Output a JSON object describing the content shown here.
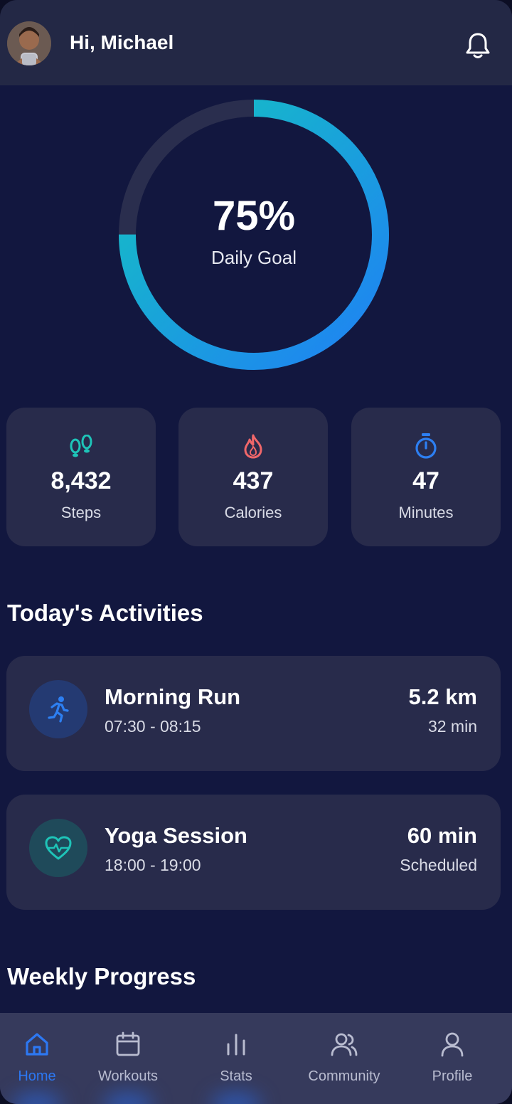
{
  "header": {
    "greeting": "Hi, Michael",
    "avatar_icon": "user-avatar-photo",
    "notification_icon": "bell-icon"
  },
  "goal": {
    "percent_text": "75%",
    "progress": 0.75,
    "label": "Daily Goal",
    "colors": {
      "track": "#2a2e4e",
      "gradient_start": "#14c4c0",
      "gradient_end": "#1f80f5"
    }
  },
  "stats": [
    {
      "value": "8,432",
      "label": "Steps",
      "icon": "footprints-icon",
      "color": "#1ec4b8"
    },
    {
      "value": "437",
      "label": "Calories",
      "icon": "flame-icon",
      "color": "#f0676a"
    },
    {
      "value": "47",
      "label": "Minutes",
      "icon": "stopwatch-icon",
      "color": "#2d7ff2"
    }
  ],
  "activities_title": "Today's Activities",
  "activities": [
    {
      "title": "Morning Run",
      "time": "07:30 - 08:15",
      "metric": "5.2 km",
      "sub": "32 min",
      "icon": "running-person-icon",
      "color": "#2d7ff2"
    },
    {
      "title": "Yoga Session",
      "time": "18:00 - 19:00",
      "metric": "60 min",
      "sub": "Scheduled",
      "icon": "heart-pulse-icon",
      "color": "#1ec4b8"
    }
  ],
  "weekly_title": "Weekly Progress",
  "nav": [
    {
      "label": "Home",
      "icon": "home-icon",
      "active": true
    },
    {
      "label": "Workouts",
      "icon": "calendar-icon",
      "active": false
    },
    {
      "label": "Stats",
      "icon": "bar-chart-icon",
      "active": false
    },
    {
      "label": "Community",
      "icon": "users-icon",
      "active": false
    },
    {
      "label": "Profile",
      "icon": "user-icon",
      "active": false
    }
  ],
  "colors": {
    "background": "#12173f",
    "card": "#282b4b",
    "accent_blue": "#2d78f2"
  }
}
